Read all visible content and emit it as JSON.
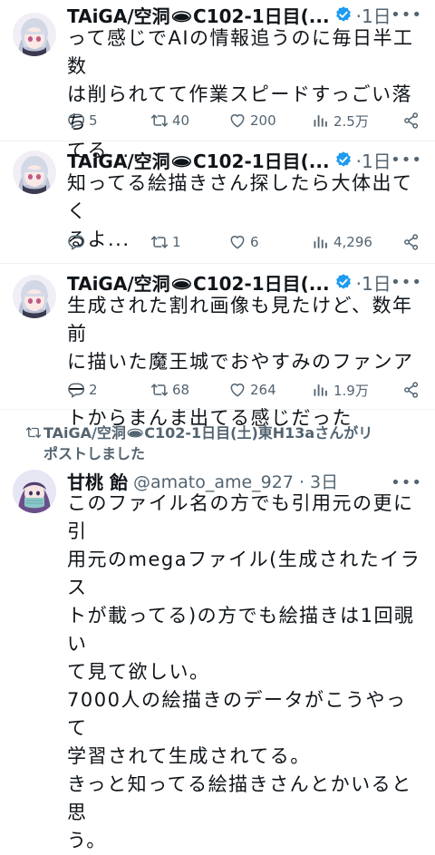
{
  "tweets": [
    {
      "name": "TAiGA/空洞🕳C102-1日目(...",
      "time": "·1日",
      "text": "って感じでAIの情報追うのに毎日半工数\nは削られてて作業スピードすっごい落ち\nてる...",
      "replies": "5",
      "retweets": "40",
      "likes": "200",
      "views": "2.5万"
    },
    {
      "name": "TAiGA/空洞🕳C102-1日目(...",
      "time": "·1日",
      "text": "知ってる絵描きさん探したら大体出てく\nるよ...",
      "replies": "",
      "retweets": "1",
      "likes": "6",
      "views": "4,296"
    },
    {
      "name": "TAiGA/空洞🕳C102-1日目(...",
      "time": "·1日",
      "text": "生成された割れ画像も見たけど、数年前\nに描いた魔王城でおやすみのファンアー\nトからまんま出てる感じだった",
      "replies": "2",
      "retweets": "68",
      "likes": "264",
      "views": "1.9万"
    }
  ],
  "repost": {
    "text": "TAiGA/空洞🕳C102-1日目(土)東H13aさんがリ\nポストしました",
    "name": "甘桃 飴",
    "handle": "@amato_ame_927 · 3日",
    "text_body": "このファイル名の方でも引用元の更に引\n用元のmegaファイル(生成されたイラス\nトが載ってる)の方でも絵描きは1回覗い\nて見て欲しい。\n7000人の絵描きのデータがこうやって\n学習されて生成されてる。\nきっと知ってる絵描きさんとかいると思\nう。"
  },
  "icons": {
    "verified": "verified-badge-icon",
    "reply": "reply-icon",
    "retweet": "retweet-icon",
    "like": "like-icon",
    "views": "views-icon",
    "share": "share-icon",
    "more": "more-icon"
  },
  "colors": {
    "verified": "#1d9bf0",
    "secondary": "#536471",
    "text": "#0f1419"
  }
}
